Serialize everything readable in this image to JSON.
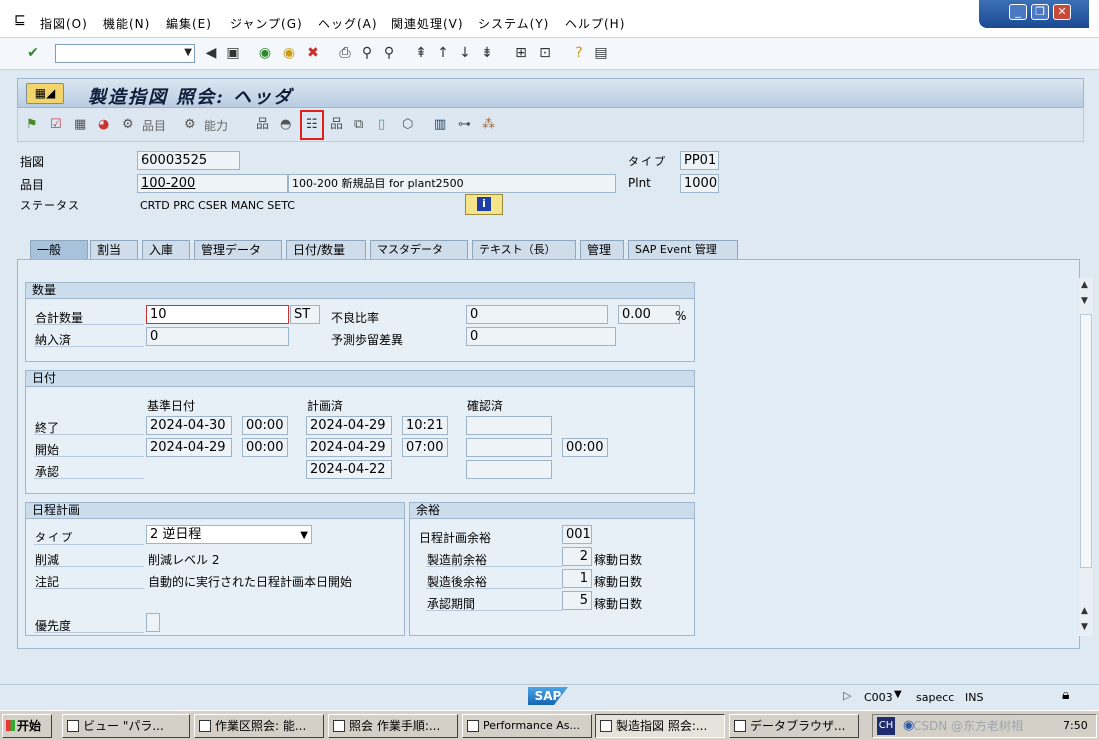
{
  "menubar": {
    "items": [
      "指図(O)",
      "機能(N)",
      "編集(E)",
      "ジャンプ(G)",
      "ヘッグ(A)",
      "関連処理(V)",
      "システム(Y)",
      "ヘルプ(H)"
    ],
    "window_controls": {
      "minimize": "_",
      "restore": "❐",
      "close": "✕"
    }
  },
  "title": {
    "text": "製造指図 照会: ヘッダ"
  },
  "app_toolbar": {
    "components_label": "品目",
    "capacity_label": "能力"
  },
  "header": {
    "order_label": "指図",
    "order_value": "60003525",
    "type_label": "タイプ",
    "type_value": "PP01",
    "material_label": "品目",
    "material_value": "100-200",
    "material_desc": "100-200 新規品目 for plant2500",
    "plant_label": "Plnt",
    "plant_value": "1000",
    "status_label": "ステータス",
    "status_value": "CRTD PRC  CSER MANC SETC"
  },
  "tabs": [
    "一般",
    "割当",
    "入庫",
    "管理データ",
    "日付/数量",
    "マスタデータ",
    "テキスト（長）",
    "管理",
    "SAP Event 管理"
  ],
  "quantities": {
    "title": "数量",
    "total_label": "合計数量",
    "total_value": "10",
    "unit": "ST",
    "scrap_label": "不良比率",
    "scrap_value": "0",
    "scrap_pct": "0.00",
    "pct_sign": "%",
    "delivered_label": "納入済",
    "delivered_value": "0",
    "expected_label": "予測歩留差異",
    "expected_value": "0"
  },
  "dates": {
    "title": "日付",
    "col_basic": "基準日付",
    "col_scheduled": "計画済",
    "col_confirmed": "確認済",
    "end_label": "終了",
    "end_basic_date": "2024-04-30",
    "end_basic_time": "00:00",
    "end_sched_date": "2024-04-29",
    "end_sched_time": "10:21",
    "start_label": "開始",
    "start_basic_date": "2024-04-29",
    "start_basic_time": "00:00",
    "start_sched_date": "2024-04-29",
    "start_sched_time": "07:00",
    "start_conf_time": "00:00",
    "release_label": "承認",
    "release_sched_date": "2024-04-22"
  },
  "scheduling": {
    "title": "日程計画",
    "type_label": "タイプ",
    "type_value": "2 逆日程",
    "reduction_label": "削減",
    "reduction_value": "削減レベル 2",
    "note_label": "注記",
    "note_value": "自動的に実行された日程計画本日開始",
    "priority_label": "優先度"
  },
  "float": {
    "title": "余裕",
    "sm_label": "日程計画余裕",
    "sm_value": "001",
    "before_label": "製造前余裕",
    "before_value": "2",
    "before_unit": "稼動日数",
    "after_label": "製造後余裕",
    "after_value": "1",
    "after_unit": "稼動日数",
    "release_label": "承認期間",
    "release_value": "5",
    "release_unit": "稼動日数"
  },
  "statusbar": {
    "logo": "SAP",
    "client": "C003",
    "server": "sapecc",
    "mode": "INS"
  },
  "taskbar": {
    "start": "开始",
    "tasks": [
      "ビュー \"パラ...",
      "作業区照会: 能...",
      "照会 作業手順:...",
      "Performance As...",
      "製造指図 照会:...",
      "データブラウザ..."
    ],
    "lang": "CH",
    "clock": "7:50",
    "watermark": "CSDN @东方老树相"
  }
}
